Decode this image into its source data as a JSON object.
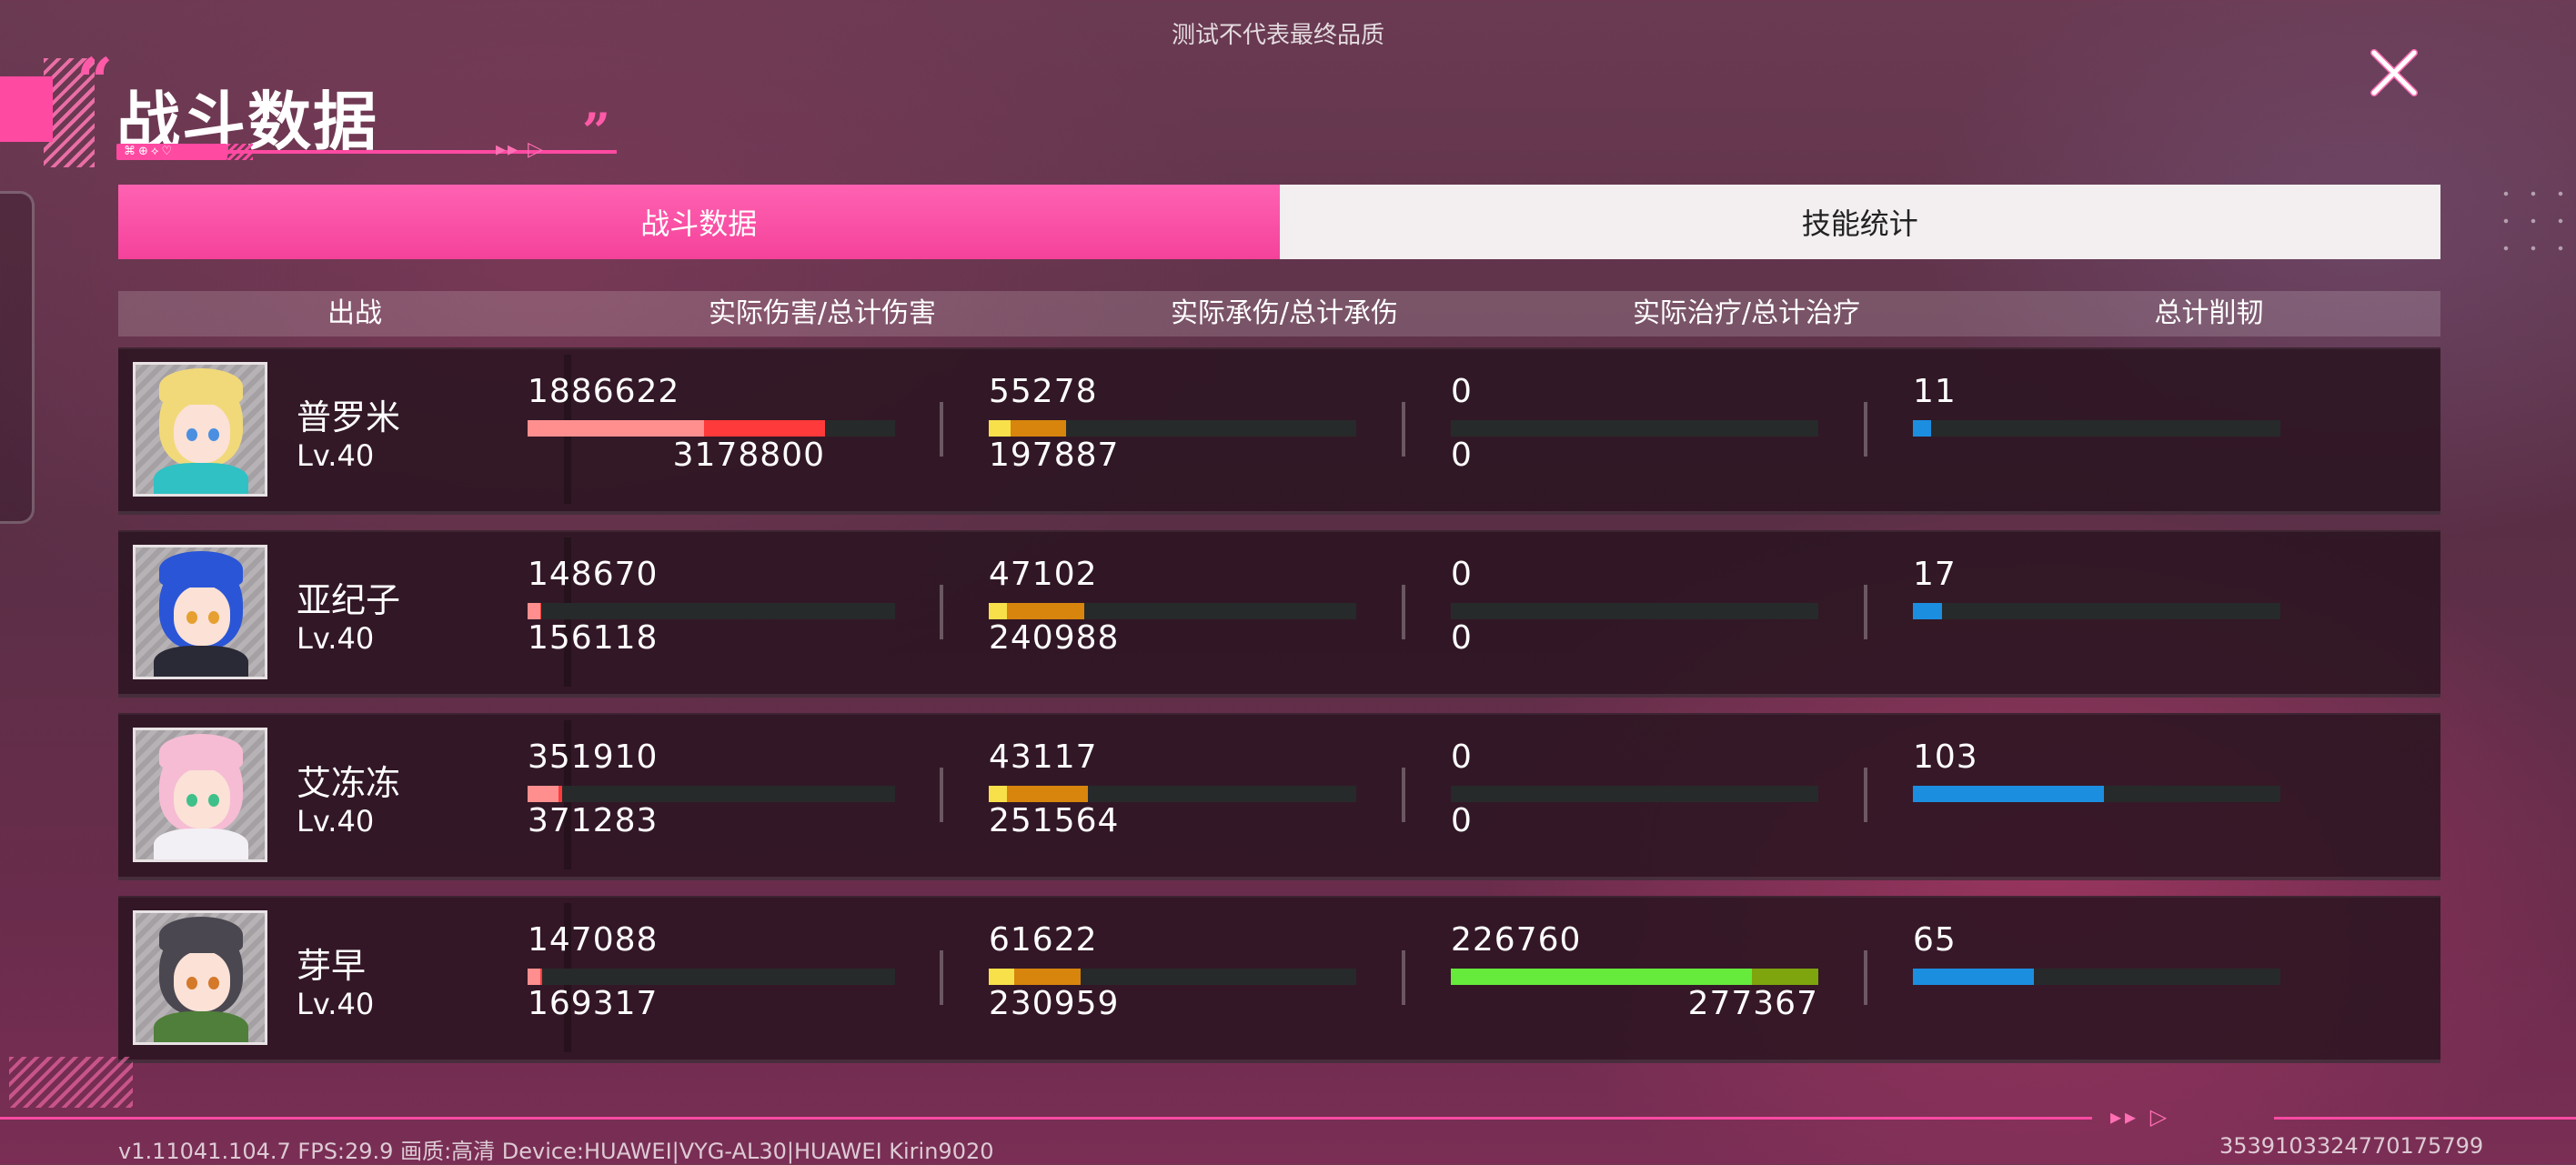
{
  "notice": "测试不代表最终品质",
  "title": {
    "text": "战斗数据",
    "tag": "⌘⊕⟡♡",
    "arrows": "▸▸ ▷"
  },
  "tabs": [
    {
      "label": "战斗数据",
      "active": true
    },
    {
      "label": "技能统计",
      "active": false
    }
  ],
  "columns": [
    "出战",
    "实际伤害/总计伤害",
    "实际承伤/总计承伤",
    "实际治疗/总计治疗",
    "总计削韧"
  ],
  "colors": {
    "accent": "#ff4aa2",
    "damage_actual": "#ff8f8f",
    "damage_total": "#ff3a3a",
    "taken_actual": "#f8e04a",
    "taken_total": "#d7850d",
    "heal_actual": "#66ea3c",
    "heal_total": "#7ea40e",
    "toughness": "#1c8ee0",
    "track": "#272a2a"
  },
  "rows": [
    {
      "name": "普罗米",
      "level": "Lv.40",
      "avatar": "blonde-girl-portrait",
      "damage": {
        "actual": "1886622",
        "total": "3178800",
        "actual_frac": 0.48,
        "total_frac": 0.81
      },
      "taken": {
        "actual": "55278",
        "total": "197887",
        "actual_frac": 0.06,
        "total_frac": 0.21
      },
      "heal": {
        "actual": "0",
        "total": "0",
        "actual_frac": 0,
        "total_frac": 0
      },
      "toughness": {
        "value": "11",
        "frac": 0.05
      }
    },
    {
      "name": "亚纪子",
      "level": "Lv.40",
      "avatar": "blue-hair-girl-portrait",
      "damage": {
        "actual": "148670",
        "total": "156118",
        "actual_frac": 0.035,
        "total_frac": 0.037
      },
      "taken": {
        "actual": "47102",
        "total": "240988",
        "actual_frac": 0.05,
        "total_frac": 0.26
      },
      "heal": {
        "actual": "0",
        "total": "0",
        "actual_frac": 0,
        "total_frac": 0
      },
      "toughness": {
        "value": "17",
        "frac": 0.08
      }
    },
    {
      "name": "艾冻冻",
      "level": "Lv.40",
      "avatar": "pink-hair-girl-portrait",
      "damage": {
        "actual": "351910",
        "total": "371283",
        "actual_frac": 0.085,
        "total_frac": 0.095
      },
      "taken": {
        "actual": "43117",
        "total": "251564",
        "actual_frac": 0.05,
        "total_frac": 0.27
      },
      "heal": {
        "actual": "0",
        "total": "0",
        "actual_frac": 0,
        "total_frac": 0
      },
      "toughness": {
        "value": "103",
        "frac": 0.52
      }
    },
    {
      "name": "芽早",
      "level": "Lv.40",
      "avatar": "dark-hair-girl-portrait",
      "damage": {
        "actual": "147088",
        "total": "169317",
        "actual_frac": 0.035,
        "total_frac": 0.04
      },
      "taken": {
        "actual": "61622",
        "total": "230959",
        "actual_frac": 0.07,
        "total_frac": 0.25
      },
      "heal": {
        "actual": "226760",
        "total": "277367",
        "actual_frac": 0.82,
        "total_frac": 1.0
      },
      "toughness": {
        "value": "65",
        "frac": 0.33
      }
    }
  ],
  "footer": {
    "version": "v1.11041.104.7 FPS:29.9 画质:高清 Device:HUAWEI|VYG-AL30|HUAWEI Kirin9020",
    "uid": "3539103324770175799"
  }
}
